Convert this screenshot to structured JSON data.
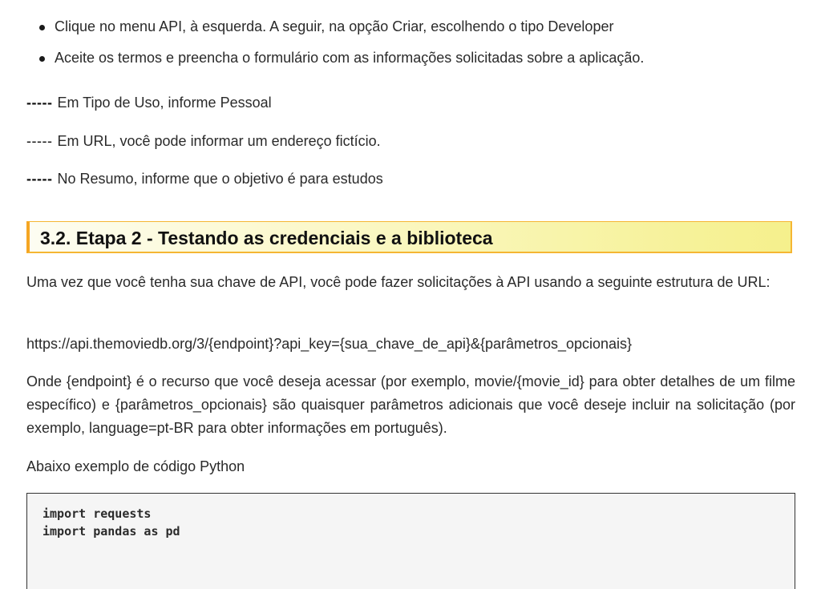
{
  "bullets": [
    "Clique no menu API, à esquerda. A seguir, na opção Criar, escolhendo o tipo Developer",
    "Aceite os termos e preencha o formulário com as informações solicitadas sobre a aplicação."
  ],
  "sub_items": [
    {
      "dash": "-----",
      "text": "Em Tipo de Uso, informe Pessoal"
    },
    {
      "dash": "-----",
      "text": "Em URL, você pode informar um endereço fictício."
    },
    {
      "dash": "-----",
      "text": "No Resumo, informe que o objetivo é para estudos"
    }
  ],
  "section_heading": "3.2. Etapa 2 - Testando as credenciais e a biblioteca",
  "paragraph_1": "Uma vez que você tenha sua chave de API, você pode fazer solicitações à API usando a seguinte estrutura de URL:",
  "url_template": "https://api.themoviedb.org/3/{endpoint}?api_key={sua_chave_de_api}&{parâmetros_opcionais}",
  "paragraph_2": "Onde {endpoint} é o recurso que você deseja acessar (por exemplo, movie/{movie_id} para obter detalhes de um filme específico) e {parâmetros_opcionais} são quaisquer parâmetros adicionais que você deseje incluir na solicitação (por exemplo, language=pt-BR para obter informações em português).",
  "code_intro": "Abaixo exemplo de código Python",
  "code_lines": [
    "import requests",
    "import pandas as pd"
  ],
  "colors": {
    "heading_accent": "#f5a623",
    "heading_bg": "#f5f08c",
    "code_bg": "#f5f5f5"
  }
}
